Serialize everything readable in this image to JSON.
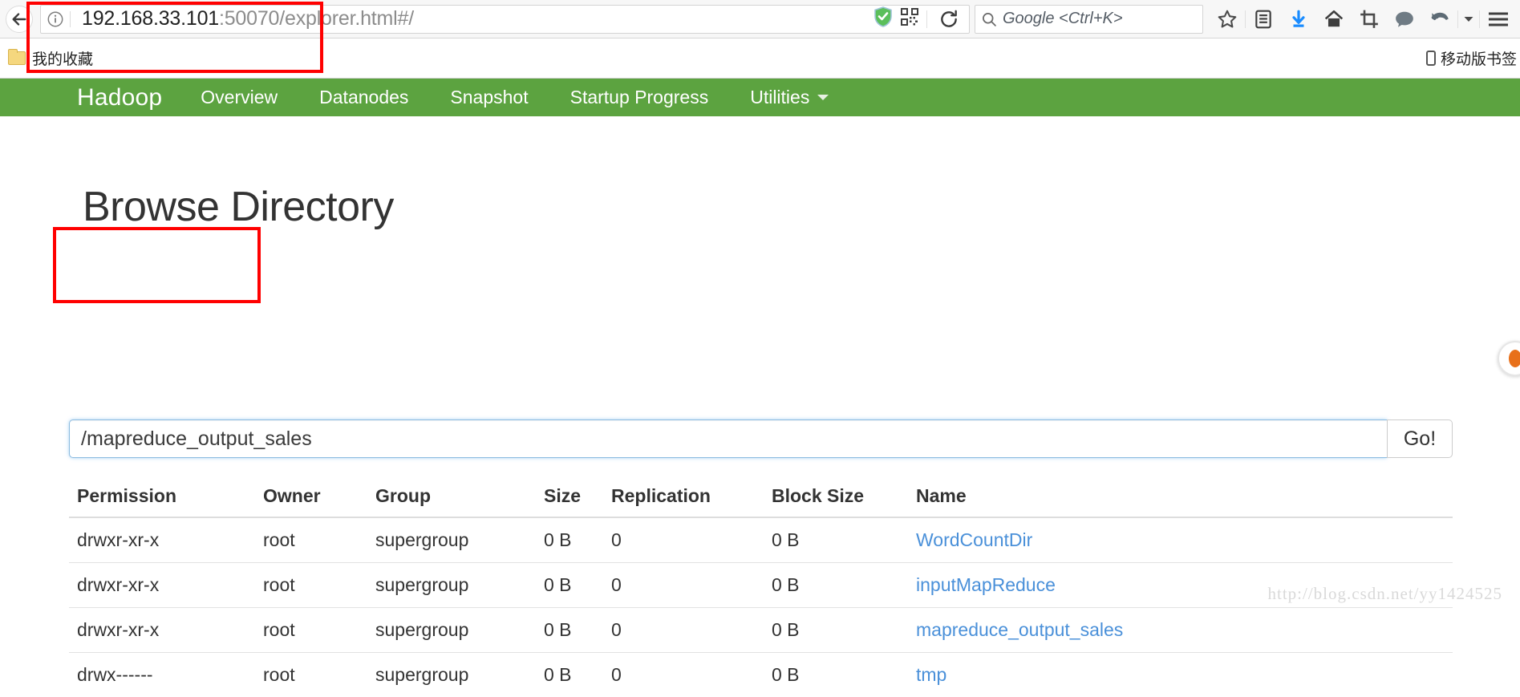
{
  "browser": {
    "back_icon": "back-arrow-icon",
    "info_icon": "page-info-icon",
    "url_host": "192.168.33.101",
    "url_path": ":50070/explorer.html#/",
    "url_full": "192.168.33.101:50070/explorer.html#/",
    "shield_icon": "security-shield-icon",
    "qr_icon": "qr-code-icon",
    "reload_icon": "reload-icon",
    "search": {
      "icon": "search-icon",
      "placeholder": "Google <Ctrl+K>"
    },
    "toolbar_icons": [
      {
        "name": "bookmark-star-icon",
        "glyph": "star"
      },
      {
        "name": "reading-list-icon",
        "glyph": "list"
      },
      {
        "name": "downloads-icon",
        "glyph": "download-arrow"
      },
      {
        "name": "home-icon",
        "glyph": "home"
      },
      {
        "name": "screenshot-crop-icon",
        "glyph": "crop"
      },
      {
        "name": "chat-bubble-icon",
        "glyph": "bubble"
      },
      {
        "name": "undo-close-tab-icon",
        "glyph": "undo-arrow"
      },
      {
        "name": "overflow-chevron-icon",
        "glyph": "chevron-down"
      },
      {
        "name": "menu-hamburger-icon",
        "glyph": "hamburger"
      }
    ]
  },
  "bookmarks": {
    "folder_label": "我的收藏",
    "mobile_label": "移动版书签"
  },
  "hadoop_nav": {
    "brand": "Hadoop",
    "links": [
      {
        "label": "Overview",
        "has_caret": false
      },
      {
        "label": "Datanodes",
        "has_caret": false
      },
      {
        "label": "Snapshot",
        "has_caret": false
      },
      {
        "label": "Startup Progress",
        "has_caret": false
      },
      {
        "label": "Utilities",
        "has_caret": true
      }
    ],
    "bg_color": "#5ca340"
  },
  "page": {
    "title": "Browse Directory",
    "path_input_value": "/mapreduce_output_sales",
    "path_input_placeholder": "",
    "go_button": "Go!"
  },
  "table": {
    "headers": [
      "Permission",
      "Owner",
      "Group",
      "Size",
      "Replication",
      "Block Size",
      "Name"
    ],
    "rows": [
      {
        "permission": "drwxr-xr-x",
        "owner": "root",
        "group": "supergroup",
        "size": "0 B",
        "replication": "0",
        "block_size": "0 B",
        "name": "WordCountDir"
      },
      {
        "permission": "drwxr-xr-x",
        "owner": "root",
        "group": "supergroup",
        "size": "0 B",
        "replication": "0",
        "block_size": "0 B",
        "name": "inputMapReduce"
      },
      {
        "permission": "drwxr-xr-x",
        "owner": "root",
        "group": "supergroup",
        "size": "0 B",
        "replication": "0",
        "block_size": "0 B",
        "name": "mapreduce_output_sales"
      },
      {
        "permission": "drwx------",
        "owner": "root",
        "group": "supergroup",
        "size": "0 B",
        "replication": "0",
        "block_size": "0 B",
        "name": "tmp"
      }
    ],
    "link_color": "#4a90d9"
  },
  "watermark": "http://blog.csdn.net/yy1424525"
}
